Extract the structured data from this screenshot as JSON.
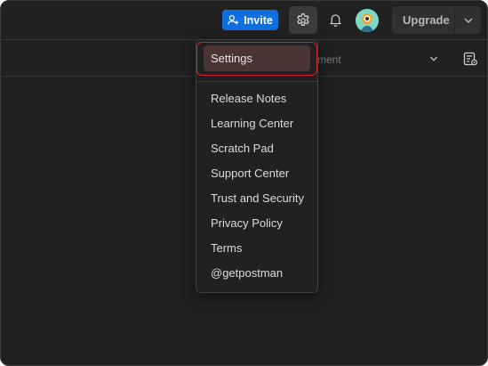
{
  "header": {
    "invite_label": "Invite",
    "upgrade_label": "Upgrade"
  },
  "subbar": {
    "environment_text": "ment"
  },
  "menu": {
    "selected_label": "Settings",
    "items": [
      "Release Notes",
      "Learning Center",
      "Scratch Pad",
      "Support Center",
      "Trust and Security",
      "Privacy Policy",
      "Terms",
      "@getpostman"
    ]
  },
  "colors": {
    "background": "#212121",
    "invite_button": "#0f6fde",
    "highlight_border": "#d8222a"
  },
  "icons": [
    "add-user-icon",
    "gear-icon",
    "bell-icon",
    "avatar",
    "chevron-down-icon",
    "environment-quick-look-icon"
  ]
}
